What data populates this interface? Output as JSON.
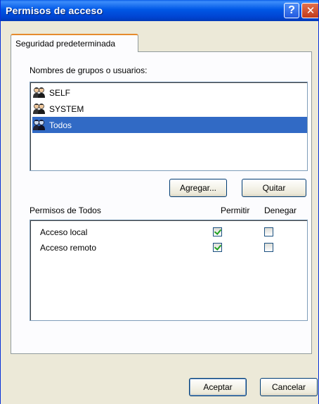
{
  "window": {
    "title": "Permisos de acceso",
    "help_label": "?",
    "close_label": "✕"
  },
  "tabs": [
    {
      "label": "Seguridad predeterminada",
      "selected": true
    }
  ],
  "groups": {
    "label": "Nombres de grupos o usuarios:",
    "items": [
      {
        "name": "SELF",
        "icon": "users-icon",
        "selected": false
      },
      {
        "name": "SYSTEM",
        "icon": "users-icon",
        "selected": false
      },
      {
        "name": "Todos",
        "icon": "users-icon",
        "selected": true
      }
    ],
    "add_label": "Agregar...",
    "remove_label": "Quitar"
  },
  "permissions": {
    "heading": "Permisos de Todos",
    "allow_header": "Permitir",
    "deny_header": "Denegar",
    "rows": [
      {
        "name": "Acceso local",
        "allow": true,
        "deny": false
      },
      {
        "name": "Acceso remoto",
        "allow": true,
        "deny": false
      }
    ]
  },
  "footer": {
    "ok_label": "Aceptar",
    "cancel_label": "Cancelar"
  },
  "colors": {
    "titlebar": "#0058e6",
    "selection": "#316ac5",
    "tab_accent": "#e68b2c",
    "check": "#21a121"
  }
}
